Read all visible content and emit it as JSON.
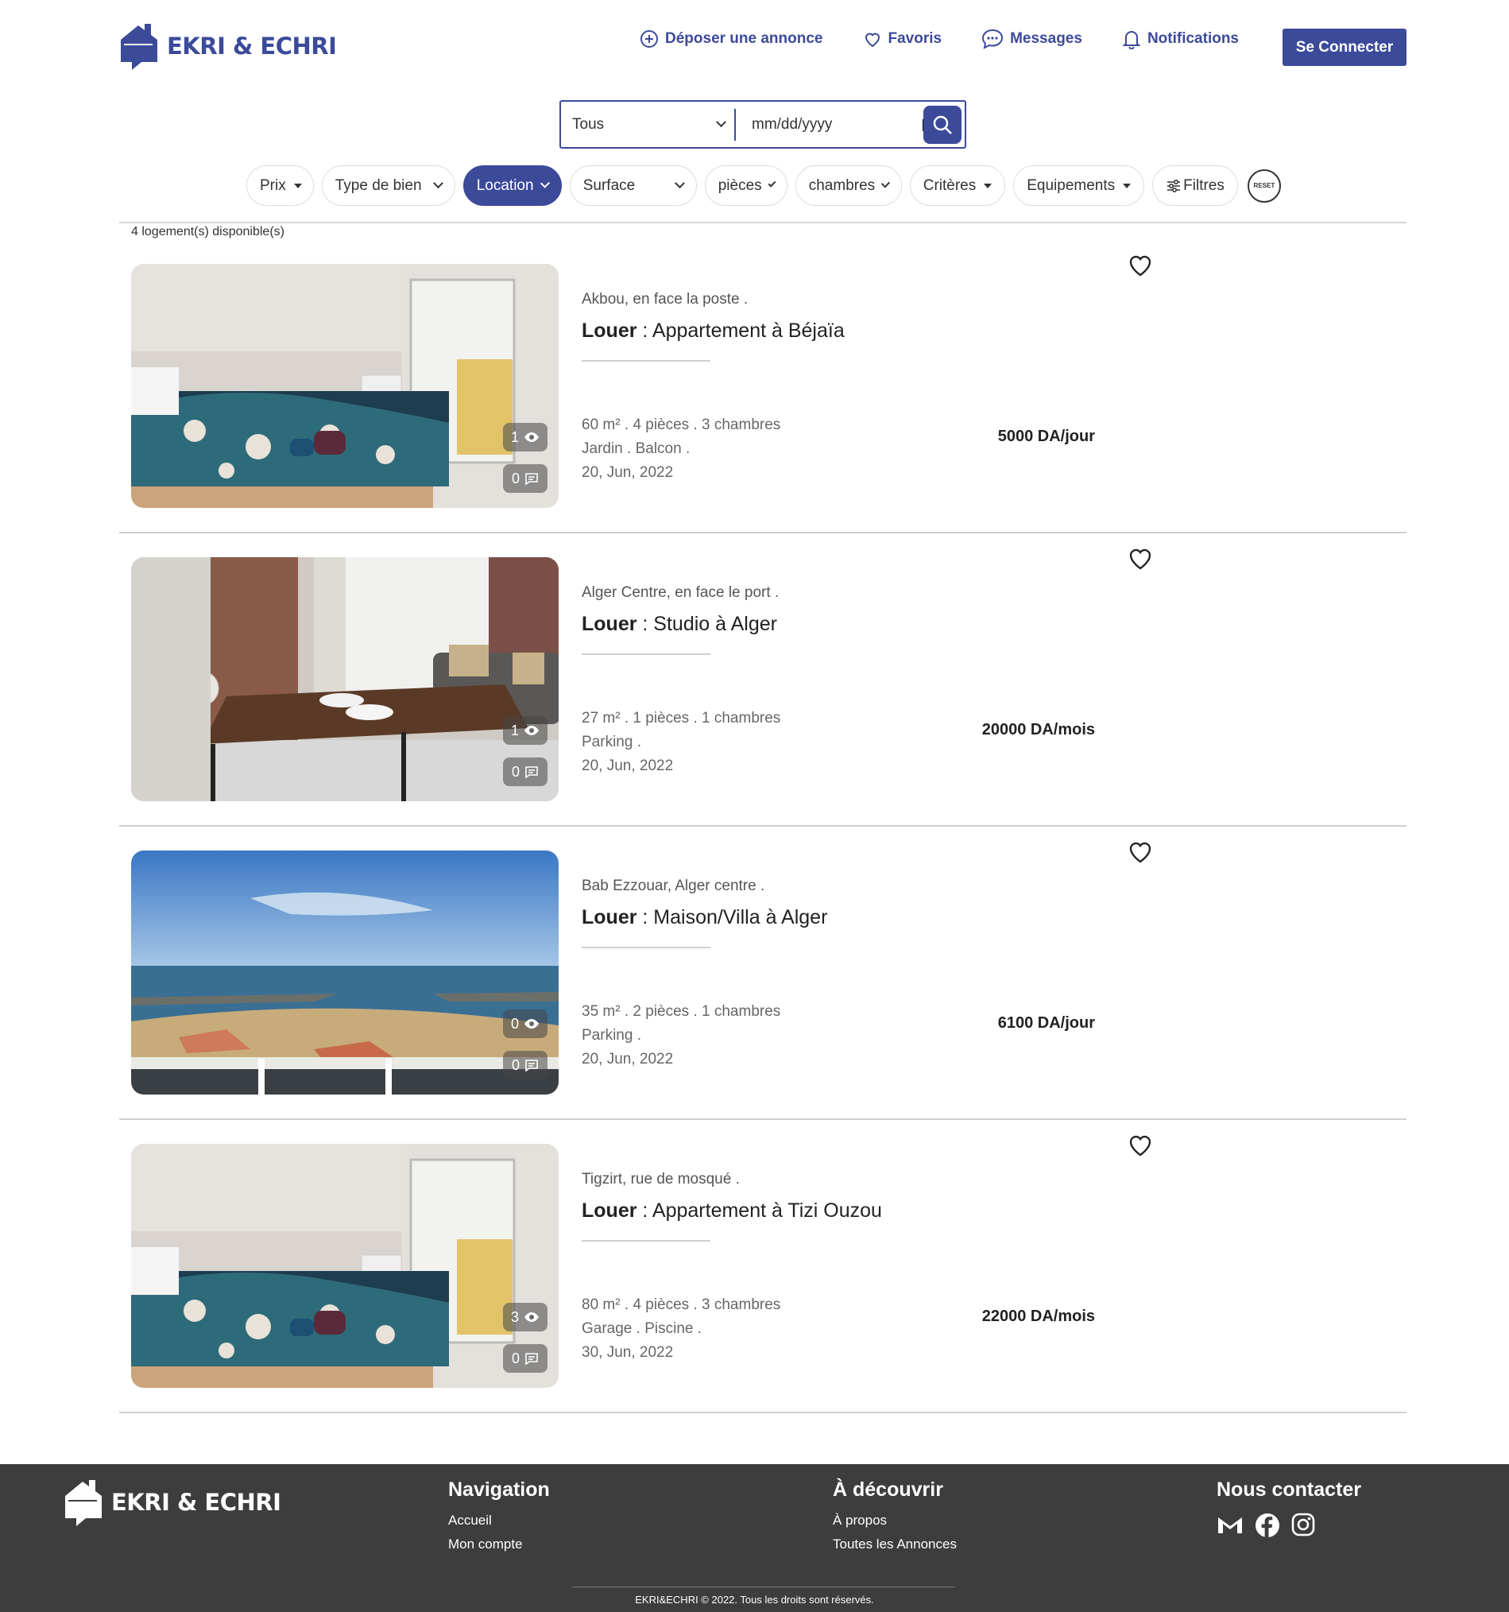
{
  "brand": {
    "name": "EKRI & ECHRI",
    "color": "#3c4a9a"
  },
  "nav": {
    "post_ad": "Déposer une annonce",
    "favorites": "Favoris",
    "messages": "Messages",
    "notifications": "Notifications",
    "login": "Se Connecter"
  },
  "search": {
    "type_value": "Tous",
    "date_placeholder": "mm/dd/yyyy"
  },
  "filters": {
    "prix": "Prix",
    "type_bien": "Type de bien",
    "location": "Location",
    "surface": "Surface",
    "pieces": "pièces",
    "chambres": "chambres",
    "criteres": "Critères",
    "equipements": "Equipements",
    "filtres": "Filtres",
    "reset": "RESET"
  },
  "results_count": "4 logement(s) disponible(s)",
  "listings": [
    {
      "location": "Akbou, en face la poste .",
      "action": "Louer",
      "title": " : Appartement à Béjaïa",
      "specs": "60 m² . 4 pièces . 3 chambres",
      "features": "Jardin . Balcon .",
      "date": "20, Jun, 2022",
      "price": "5000 DA/jour",
      "views": "1",
      "comments": "0",
      "photo": "bedroom"
    },
    {
      "location": "Alger Centre, en face le port .",
      "action": "Louer",
      "title": " : Studio à Alger",
      "specs": "27 m² . 1 pièces . 1 chambres",
      "features": "Parking .",
      "date": "20, Jun, 2022",
      "price": "20000 DA/mois",
      "views": "1",
      "comments": "0",
      "photo": "living-room"
    },
    {
      "location": "Bab Ezzouar, Alger centre .",
      "action": "Louer",
      "title": " : Maison/Villa à Alger",
      "specs": "35 m² . 2 pièces . 1 chambres",
      "features": "Parking .",
      "date": "20, Jun, 2022",
      "price": "6100 DA/jour",
      "views": "0",
      "comments": "0",
      "photo": "sea-view"
    },
    {
      "location": "Tigzirt, rue de mosqué .",
      "action": "Louer",
      "title": " : Appartement à Tizi Ouzou",
      "specs": "80 m² . 4 pièces . 3 chambres",
      "features": "Garage . Piscine .",
      "date": "30, Jun, 2022",
      "price": "22000 DA/mois",
      "views": "3",
      "comments": "0",
      "photo": "bedroom"
    }
  ],
  "footer": {
    "brand": "EKRI & ECHRI",
    "nav_title": "Navigation",
    "nav_links": [
      "Accueil",
      "Mon compte"
    ],
    "discover_title": "À découvrir",
    "discover_links": [
      "À propos",
      "Toutes les Annonces"
    ],
    "contact_title": "Nous contacter",
    "contact_icons": [
      "gmail-icon",
      "facebook-icon",
      "instagram-icon"
    ],
    "copyright": "EKRI&ECHRI © 2022. Tous les droits sont réservés."
  }
}
